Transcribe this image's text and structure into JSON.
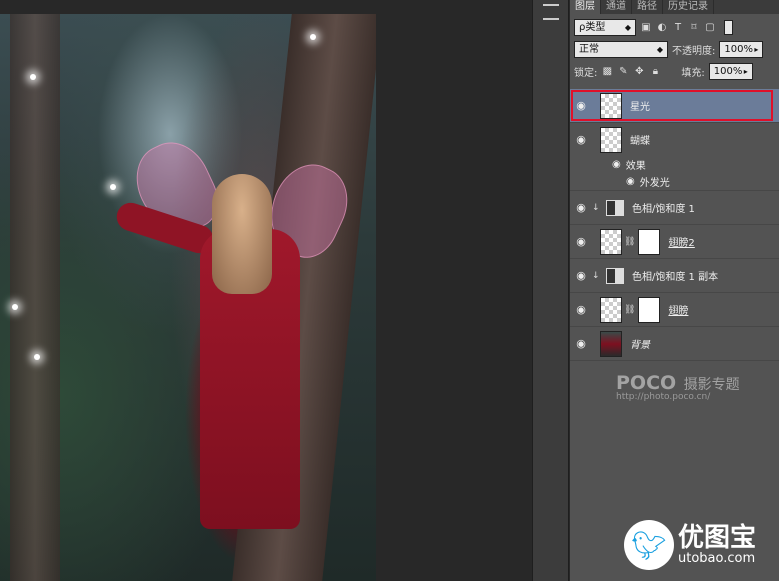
{
  "panel": {
    "tabs": [
      "图层",
      "通道",
      "路径",
      "历史记录"
    ],
    "filter_label": "ρ类型",
    "blend_mode": "正常",
    "opacity_label": "不透明度:",
    "opacity_value": "100%",
    "lock_label": "锁定:",
    "fill_label": "填充:",
    "fill_value": "100%"
  },
  "layers": [
    {
      "name": "星光",
      "selected": true
    },
    {
      "name": "蝴蝶"
    },
    {
      "name": "效果",
      "type": "effect-group"
    },
    {
      "name": "外发光",
      "type": "effect"
    },
    {
      "name": "色相/饱和度 1",
      "type": "adjustment"
    },
    {
      "name": "翅膀2",
      "type": "masked"
    },
    {
      "name": "色相/饱和度 1 副本",
      "type": "adjustment"
    },
    {
      "name": "翅膀",
      "type": "masked"
    },
    {
      "name": "背景",
      "type": "background"
    }
  ],
  "watermark": {
    "logo": "POCO",
    "logo_cn": "摄影专题",
    "url": "http://photo.poco.cn/"
  },
  "brand": {
    "cn": "优图宝",
    "en": "utobao.com"
  }
}
